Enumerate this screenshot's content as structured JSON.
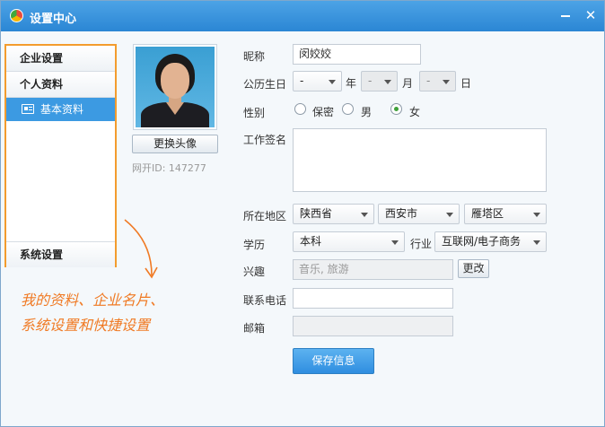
{
  "window": {
    "title": "设置中心"
  },
  "sidebar": {
    "company": "企业设置",
    "personal": "个人资料",
    "basic": "基本资料",
    "system": "系统设置"
  },
  "annotation": {
    "line1": "我的资料、企业名片、",
    "line2": "系统设置和快捷设置"
  },
  "profile": {
    "change_avatar": "更换头像",
    "net_id": "网开ID: 147277"
  },
  "form": {
    "nickname_label": "昵称",
    "nickname_value": "闵姣姣",
    "birthday_label": "公历生日",
    "year_value": "-",
    "year_unit": "年",
    "month_value": "-",
    "month_unit": "月",
    "day_value": "-",
    "day_unit": "日",
    "gender_label": "性别",
    "gender_options": [
      "保密",
      "男",
      "女"
    ],
    "gender_selected": "女",
    "signature_label": "工作签名",
    "region_label": "所在地区",
    "province": "陕西省",
    "city": "西安市",
    "district": "雁塔区",
    "education_label": "学历",
    "education_value": "本科",
    "industry_label": "行业",
    "industry_value": "互联网/电子商务",
    "interest_label": "兴趣",
    "interest_placeholder": "音乐, 旅游",
    "interest_button": "更改",
    "phone_label": "联系电话",
    "phone_value": "",
    "email_label": "邮箱",
    "email_value": "",
    "save_button": "保存信息"
  },
  "colors": {
    "titlebar": "#2b86d4",
    "sidebar_border": "#f39c2e",
    "active_item": "#3c9ae2",
    "annotation": "#f07a24",
    "save_button": "#2f8ee0"
  }
}
